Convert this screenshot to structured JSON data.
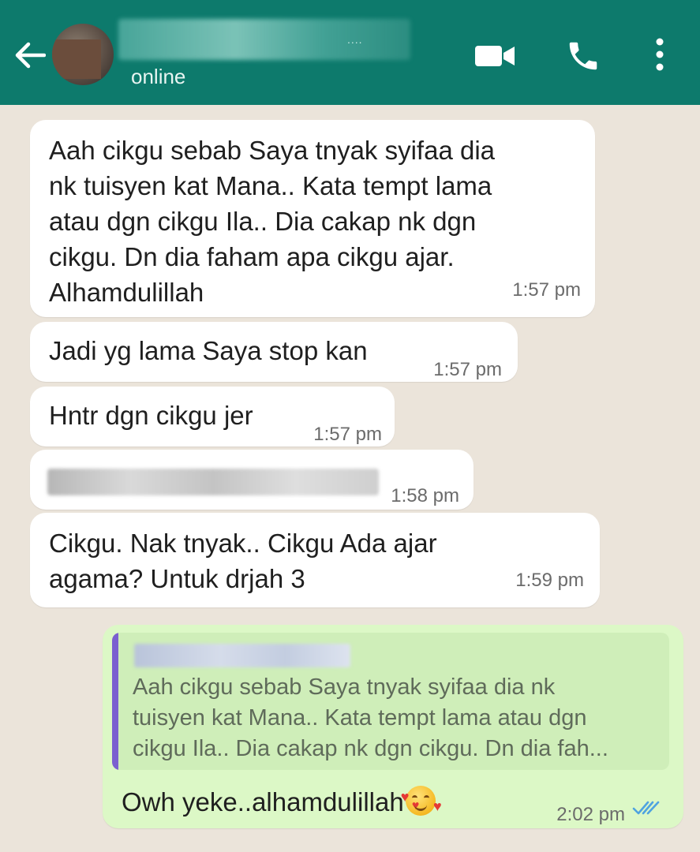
{
  "header": {
    "status": "online"
  },
  "messages": [
    {
      "text": "Aah cikgu sebab Saya tnyak syifaa dia\nnk tuisyen kat Mana.. Kata tempt lama\natau dgn cikgu Ila.. Dia cakap nk dgn\ncikgu. Dn dia faham apa cikgu ajar.\nAlhamdulillah",
      "time": "1:57 pm"
    },
    {
      "text": "Jadi yg lama Saya stop kan",
      "time": "1:57 pm"
    },
    {
      "text": "Hntr dgn cikgu jer",
      "time": "1:57 pm"
    },
    {
      "text": "",
      "time": "1:58 pm"
    },
    {
      "text": "Cikgu. Nak tnyak.. Cikgu Ada ajar\nagama? Untuk drjah 3",
      "time": "1:59 pm"
    }
  ],
  "outgoing": {
    "quoted_text": "Aah cikgu sebab Saya tnyak syifaa dia nk\ntuisyen kat Mana.. Kata tempt lama atau dgn\ncikgu Ila.. Dia cakap nk dgn cikgu. Dn dia fah...",
    "text": "Owh yeke..alhamdulillah",
    "time": "2:02 pm"
  },
  "colors": {
    "header": "#0d7a6c",
    "incoming_bubble": "#ffffff",
    "outgoing_bubble": "#dcf8c6",
    "quote_bar": "#7b5fd0",
    "read_ticks": "#4fa3e0"
  },
  "icons": [
    "back-arrow-icon",
    "video-call-icon",
    "phone-icon",
    "more-vert-icon",
    "double-tick-icon",
    "smiling-face-with-hearts-emoji"
  ]
}
